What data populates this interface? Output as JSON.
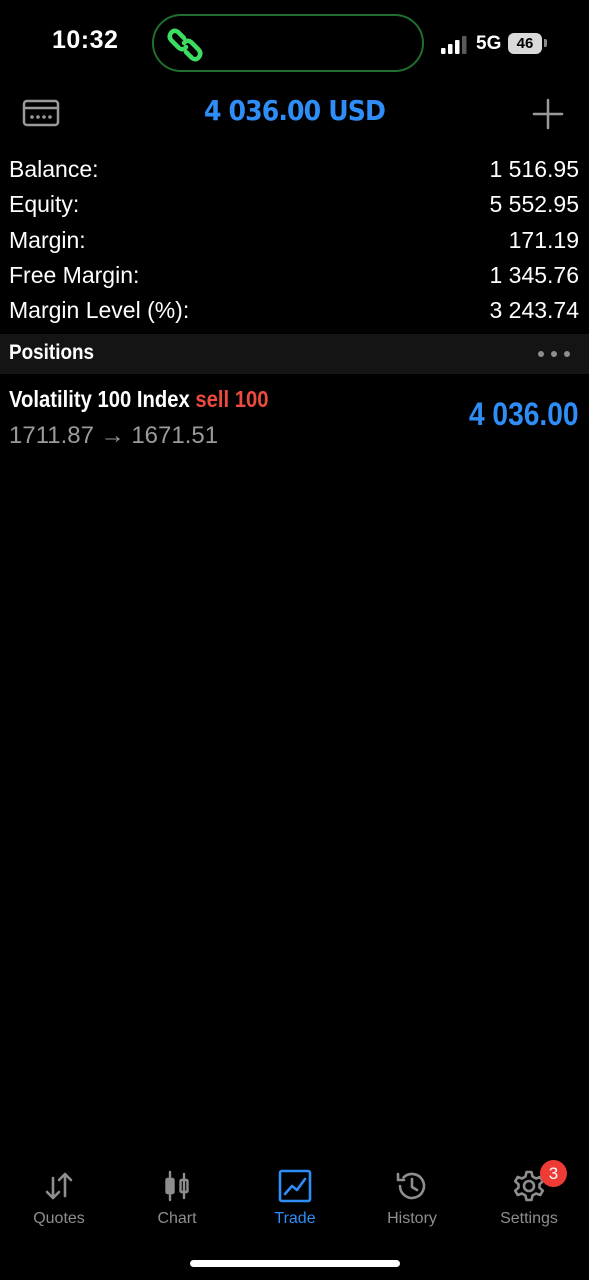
{
  "status_bar": {
    "time": "10:32",
    "network": "5G",
    "battery": "46",
    "island_icon": "link-icon"
  },
  "header": {
    "title": "4 036.00 USD",
    "left_icon": "wallet-icon",
    "right_icon": "plus-icon"
  },
  "summary": [
    {
      "label": "Balance:",
      "value": "1 516.95"
    },
    {
      "label": "Equity:",
      "value": "5 552.95"
    },
    {
      "label": "Margin:",
      "value": "171.19"
    },
    {
      "label": "Free Margin:",
      "value": "1 345.76"
    },
    {
      "label": "Margin Level (%):",
      "value": "3 243.74"
    }
  ],
  "positions": {
    "title": "Positions",
    "items": [
      {
        "symbol": "Volatility 100 Index",
        "side": "sell 100",
        "open_price": "1711.87",
        "arrow": "→",
        "current_price": "1671.51",
        "profit": "4 036.00"
      }
    ]
  },
  "tabs": [
    {
      "label": "Quotes",
      "icon": "quotes-arrows-icon"
    },
    {
      "label": "Chart",
      "icon": "candlestick-icon"
    },
    {
      "label": "Trade",
      "icon": "trade-chart-icon",
      "active": true
    },
    {
      "label": "History",
      "icon": "history-clock-icon"
    },
    {
      "label": "Settings",
      "icon": "gear-icon",
      "badge": "3"
    }
  ],
  "colors": {
    "accent": "#2f8df7",
    "sell": "#ee4b3e",
    "badge": "#ee3b36",
    "secondary_text": "#9a9a9a"
  }
}
